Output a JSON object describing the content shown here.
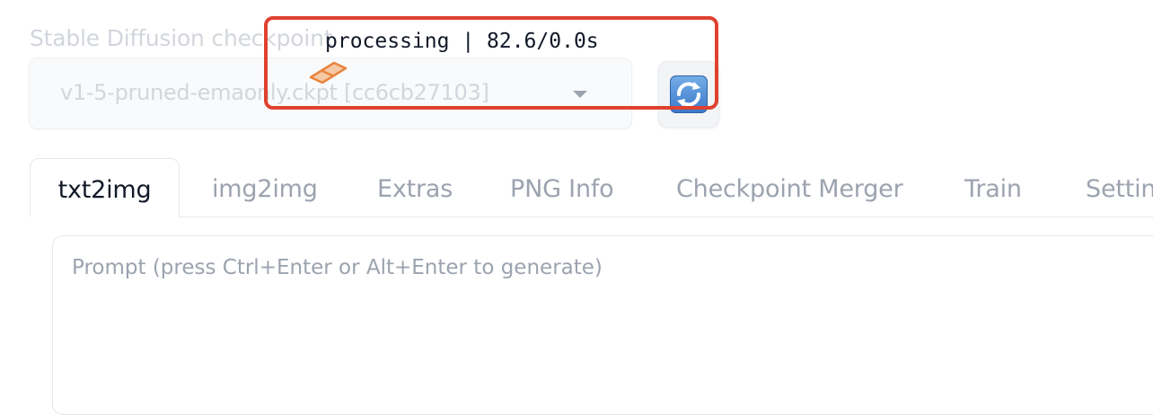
{
  "checkpoint": {
    "label": "Stable Diffusion checkpoint",
    "selected_value": "v1-5-pruned-emaonly.ckpt [cc6cb27103]"
  },
  "refresh_button": {
    "icon": "refresh-icon"
  },
  "progress": {
    "status_text": "processing | 82.6/0.0s",
    "highlight_color": "#e0412f",
    "bar_color": "#e8843c"
  },
  "tabs": [
    {
      "label": "txt2img",
      "active": true
    },
    {
      "label": "img2img",
      "active": false
    },
    {
      "label": "Extras",
      "active": false
    },
    {
      "label": "PNG Info",
      "active": false
    },
    {
      "label": "Checkpoint Merger",
      "active": false
    },
    {
      "label": "Train",
      "active": false
    },
    {
      "label": "Settin",
      "active": false
    }
  ],
  "prompt": {
    "value": "",
    "placeholder": "Prompt (press Ctrl+Enter or Alt+Enter to generate)"
  }
}
